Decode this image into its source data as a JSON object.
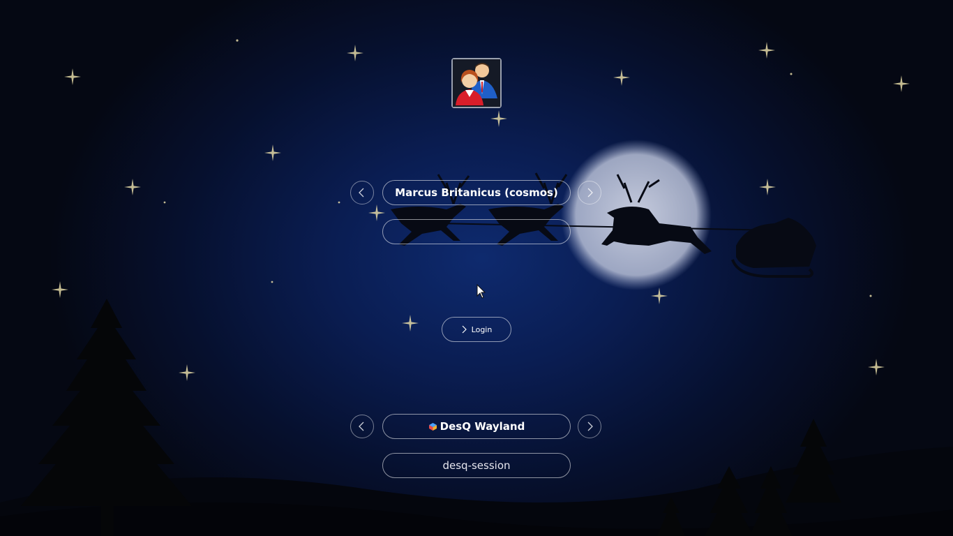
{
  "user": {
    "display_name": "Marcus Britanicus (cosmos)",
    "avatar_icon": "users-icon",
    "prev_icon": "chevron-left-icon",
    "next_icon": "chevron-right-icon"
  },
  "password": {
    "value": "",
    "placeholder": ""
  },
  "login": {
    "label": "Login",
    "icon": "chevron-right-icon"
  },
  "session": {
    "name": "DesQ Wayland",
    "icon": "desq-logo-icon",
    "command": "desq-session",
    "prev_icon": "chevron-left-icon",
    "next_icon": "chevron-right-icon"
  },
  "colors": {
    "background_center": "#0e2a6e",
    "background_edge": "#050813",
    "moon": "#c9cfe0",
    "pill_border": "#ffffff",
    "star": "#e8dca8"
  }
}
